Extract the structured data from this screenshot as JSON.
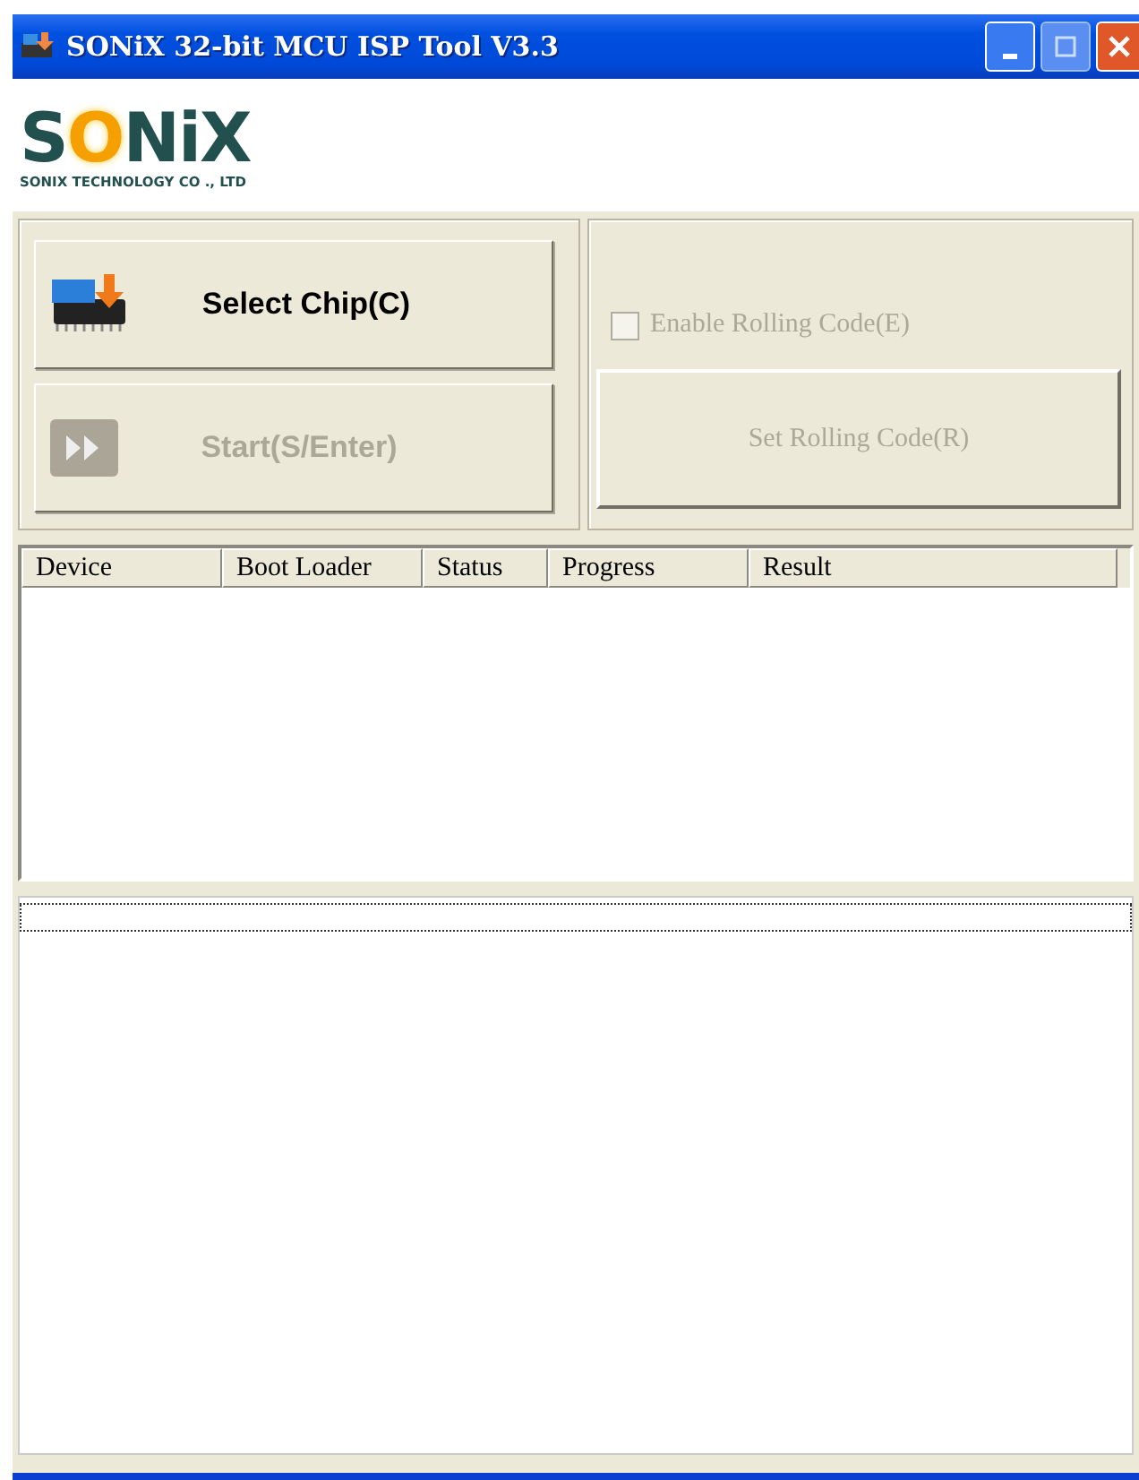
{
  "window": {
    "title": "SONiX 32-bit MCU ISP Tool V3.3"
  },
  "logo": {
    "name": "SONiX",
    "tagline": "SONIX TECHNOLOGY CO ., LTD"
  },
  "buttons": [
    {
      "label": "Select Chip(C)",
      "disabled": false,
      "kind": "chip"
    },
    {
      "label": "Start(S/Enter)",
      "disabled": true,
      "kind": "play"
    }
  ],
  "rolling": {
    "checkbox": {
      "label": "Enable Rolling Code(E)",
      "checked": false,
      "disabled": true
    },
    "button": {
      "label": "Set Rolling Code(R)",
      "disabled": true
    }
  },
  "table": {
    "columns": [
      "Device",
      "Boot Loader",
      "Status",
      "Progress",
      "Result"
    ]
  }
}
